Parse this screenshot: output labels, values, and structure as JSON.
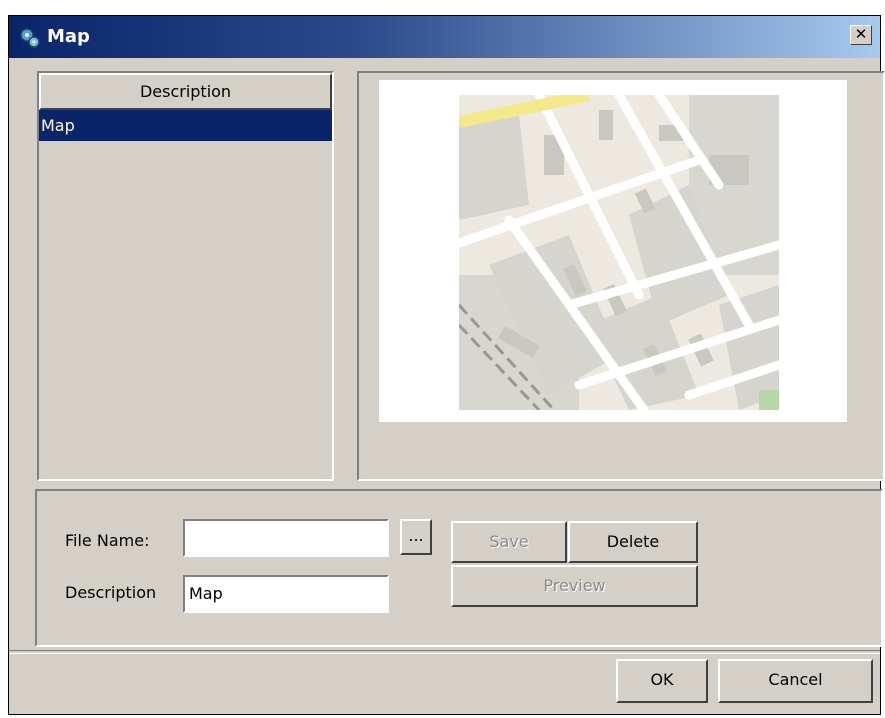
{
  "window": {
    "title": "Map",
    "close_label": "✕"
  },
  "list": {
    "header": "Description",
    "items": [
      "Map"
    ]
  },
  "form": {
    "file_name_label": "File Name:",
    "file_name_value": "",
    "browse_label": "...",
    "description_label": "Description",
    "description_value": "Map",
    "save_label": "Save",
    "delete_label": "Delete",
    "preview_label": "Preview"
  },
  "footer": {
    "ok_label": "OK",
    "cancel_label": "Cancel"
  },
  "colors": {
    "selection": "#0a246a",
    "dialog_bg": "#d4d0c8"
  }
}
